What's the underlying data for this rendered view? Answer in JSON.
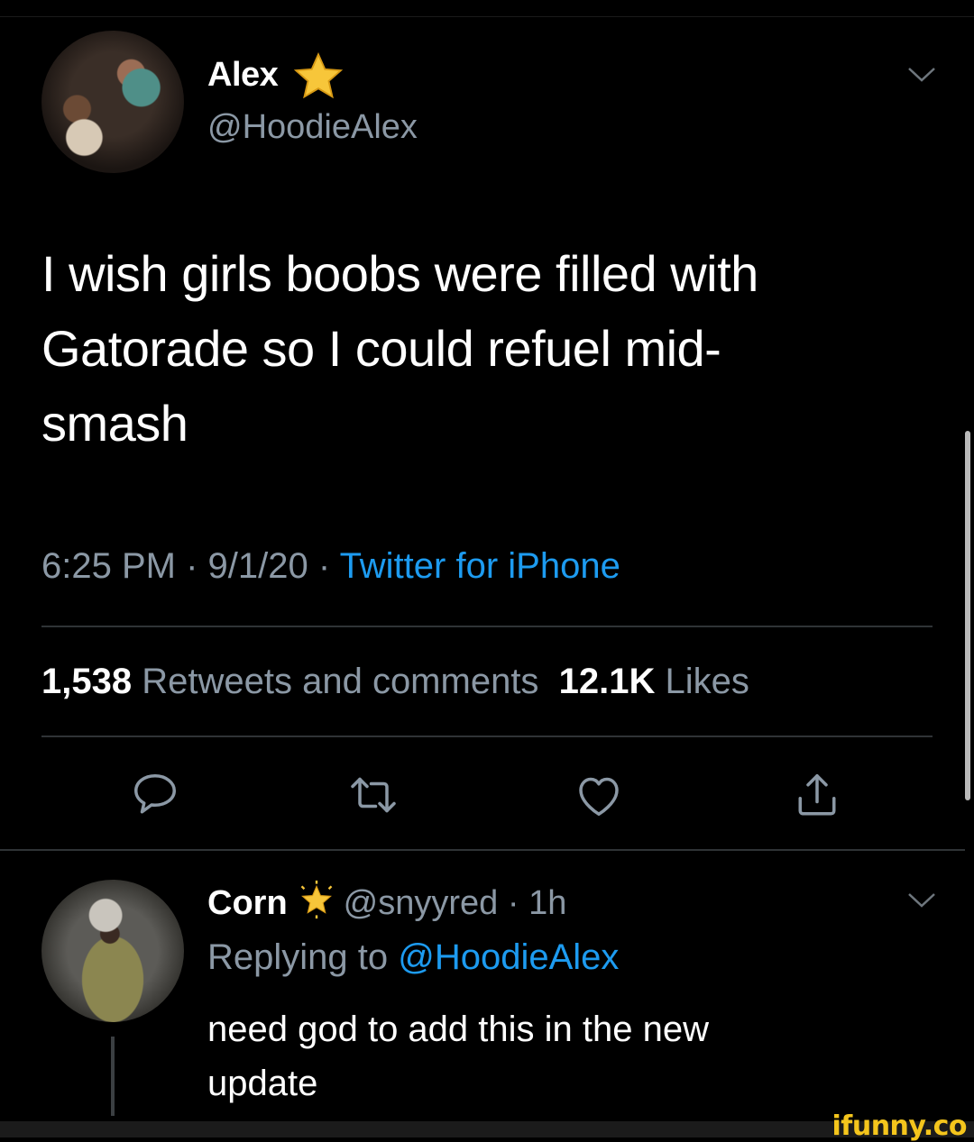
{
  "tweet": {
    "author_name": "Alex",
    "author_handle": "@HoodieAlex",
    "text_lines": [
      "I wish girls boobs were filled with",
      "Gatorade so I could refuel mid-",
      "smash"
    ],
    "time": "6:25 PM",
    "date": "9/1/20",
    "source": "Twitter for iPhone",
    "retweets_count": "1,538",
    "retweets_label": "Retweets and comments",
    "likes_count": "12.1K",
    "likes_label": "Likes"
  },
  "actions": {
    "reply_icon": "speech-bubble-icon",
    "retweet_icon": "retweet-icon",
    "like_icon": "heart-icon",
    "share_icon": "share-icon"
  },
  "reply": {
    "author_name": "Corn",
    "author_handle": "@snyyred",
    "age": "1h",
    "replying_prefix": "Replying to",
    "replying_handle": "@HoodieAlex",
    "text_lines": [
      "need god to add this in the new",
      "update"
    ]
  },
  "watermark": "ifunny.co",
  "colors": {
    "background": "#000000",
    "secondary_text": "#8b98a5",
    "link": "#1d9bf0",
    "divider": "#2f3336",
    "watermark": "#f4c51c"
  }
}
